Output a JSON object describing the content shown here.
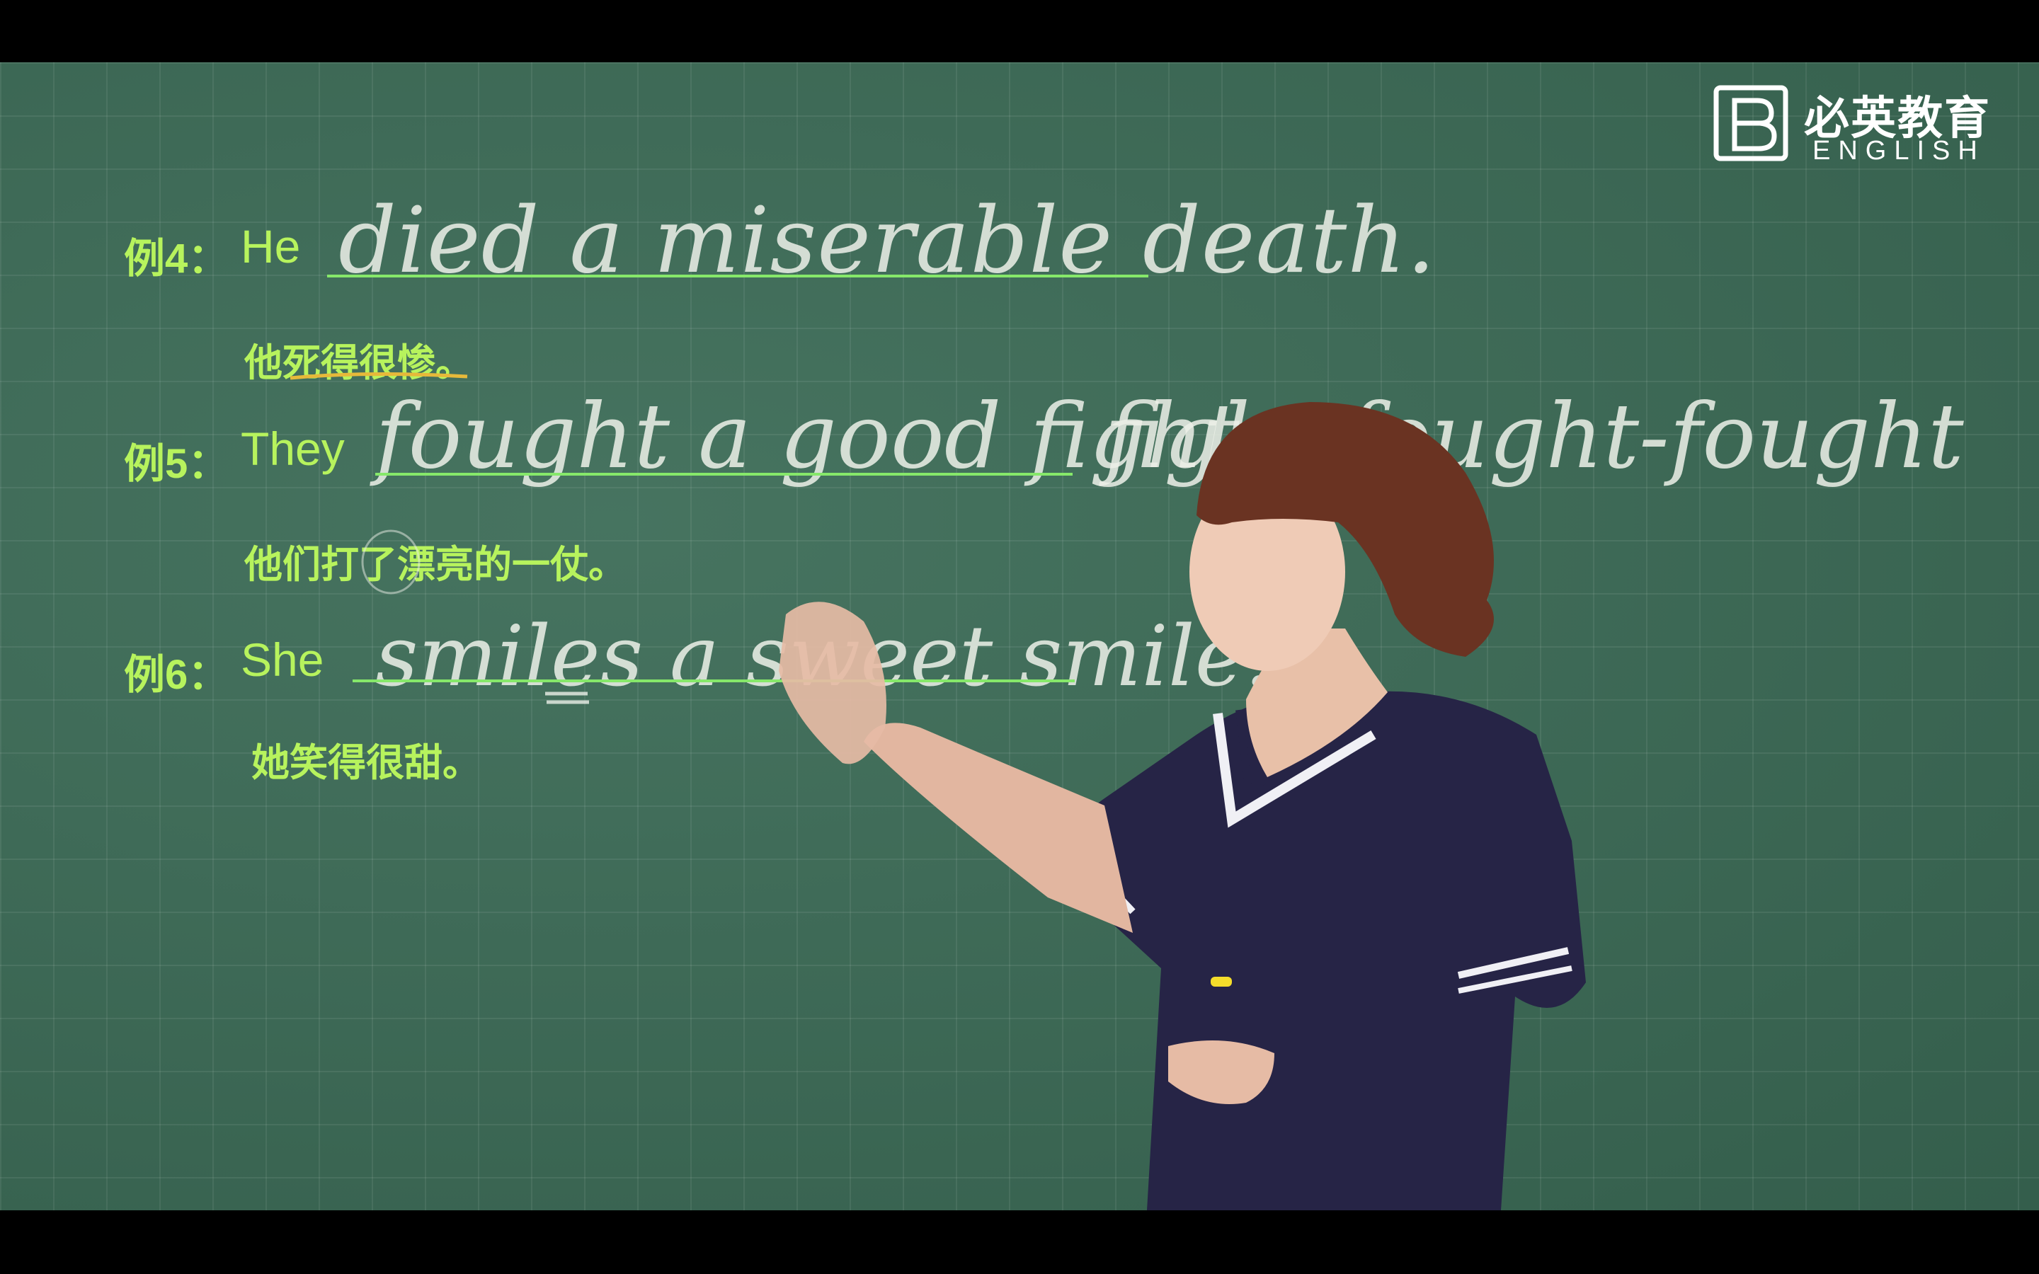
{
  "logo": {
    "name_cn": "必英教育",
    "name_en": "ENGLISH"
  },
  "examples": [
    {
      "label": "例4：",
      "subject": "He",
      "chalk": "died a miserable death.",
      "translation": "他死得很惨。"
    },
    {
      "label": "例5：",
      "subject": "They",
      "chalk": "fought a good fight.",
      "chalk_extra": "fight-fought-fought",
      "translation": "他们打了漂亮的一仗。"
    },
    {
      "label": "例6：",
      "subject": "She",
      "chalk": "smiles a sweet smile.",
      "translation": "她笑得很甜。"
    }
  ],
  "colors": {
    "board": "#3b6b56",
    "highlight_text": "#b7f35d",
    "underline": "#86e86a",
    "chalk": "#ecf0e8",
    "annotation": "#e6b93a"
  }
}
